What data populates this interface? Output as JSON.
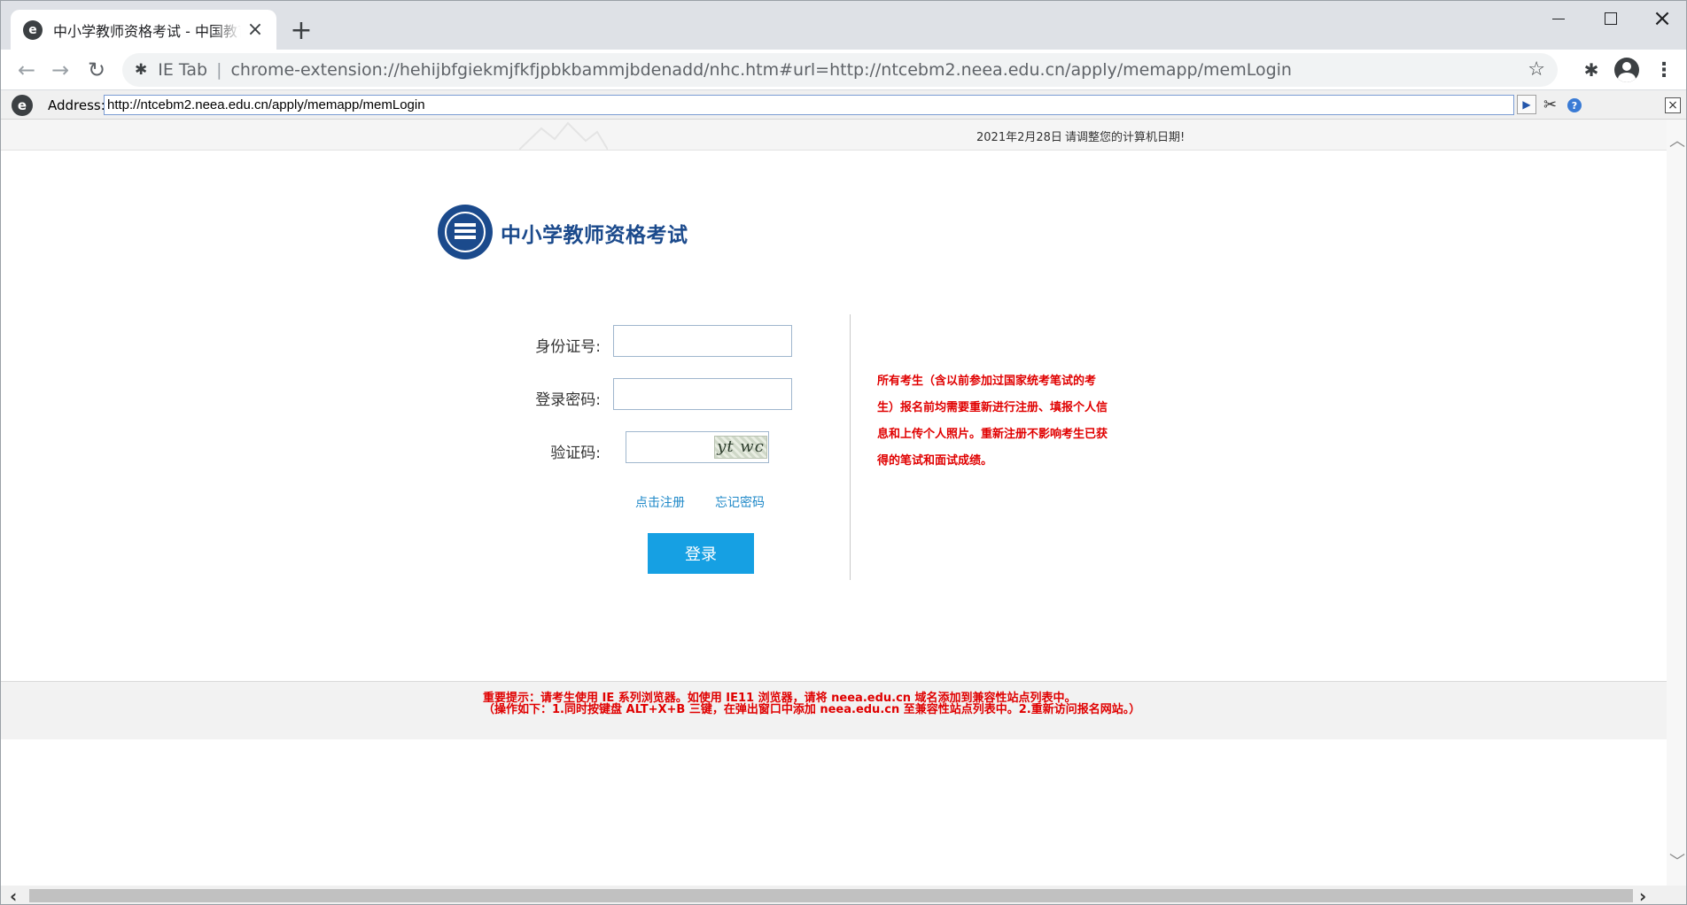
{
  "browser": {
    "tab_title": "中小学教师资格考试 - 中国教育考试网",
    "omnibox_label": "IE Tab",
    "omnibox_url": "chrome-extension://hehijbfgiekmjfkfjpbkbammjbdenadd/nhc.htm#url=http://ntcebm2.neea.edu.cn/apply/memapp/memLogin"
  },
  "ie_bar": {
    "address_label": "Address:",
    "address_value": "http://ntcebm2.neea.edu.cn/apply/memapp/memLogin"
  },
  "page": {
    "date": "2021年2月28日",
    "date_warning": "请调整您的计算机日期!",
    "site_title": "中小学教师资格考试",
    "form": {
      "id_label": "身份证号:",
      "password_label": "登录密码:",
      "captcha_label": "验证码:",
      "captcha_text": "yt wc",
      "register_link": "点击注册",
      "forgot_link": "忘记密码",
      "login_button": "登录"
    },
    "notice": [
      "所有考生（含以前参加过国家统考笔试的考",
      "生）报名前均需要重新进行注册、填报个人信",
      "息和上传个人照片。重新注册不影响考生已获",
      "得的笔试和面试成绩。"
    ],
    "footer": {
      "line1": "重要提示：请考生使用 IE 系列浏览器。如使用 IE11 浏览器，请将 neea.edu.cn 域名添加到兼容性站点列表中。",
      "line2": "（操作如下：1.同时按键盘 ALT+X+B 三键，在弹出窗口中添加 neea.edu.cn 至兼容性站点列表中。2.重新访问报名网站。）"
    }
  },
  "colors": {
    "brand_blue": "#1b4a8c",
    "button_blue": "#16a0e3",
    "link_blue": "#1e88c8",
    "alert_red": "#e00000"
  },
  "icons": [
    "ie-favicon-icon",
    "close-icon",
    "plus-icon",
    "back-arrow-icon",
    "forward-arrow-icon",
    "reload-icon",
    "puzzle-icon",
    "star-icon",
    "profile-icon",
    "kebab-menu-icon",
    "go-arrow-icon",
    "tools-icon",
    "help-icon"
  ]
}
